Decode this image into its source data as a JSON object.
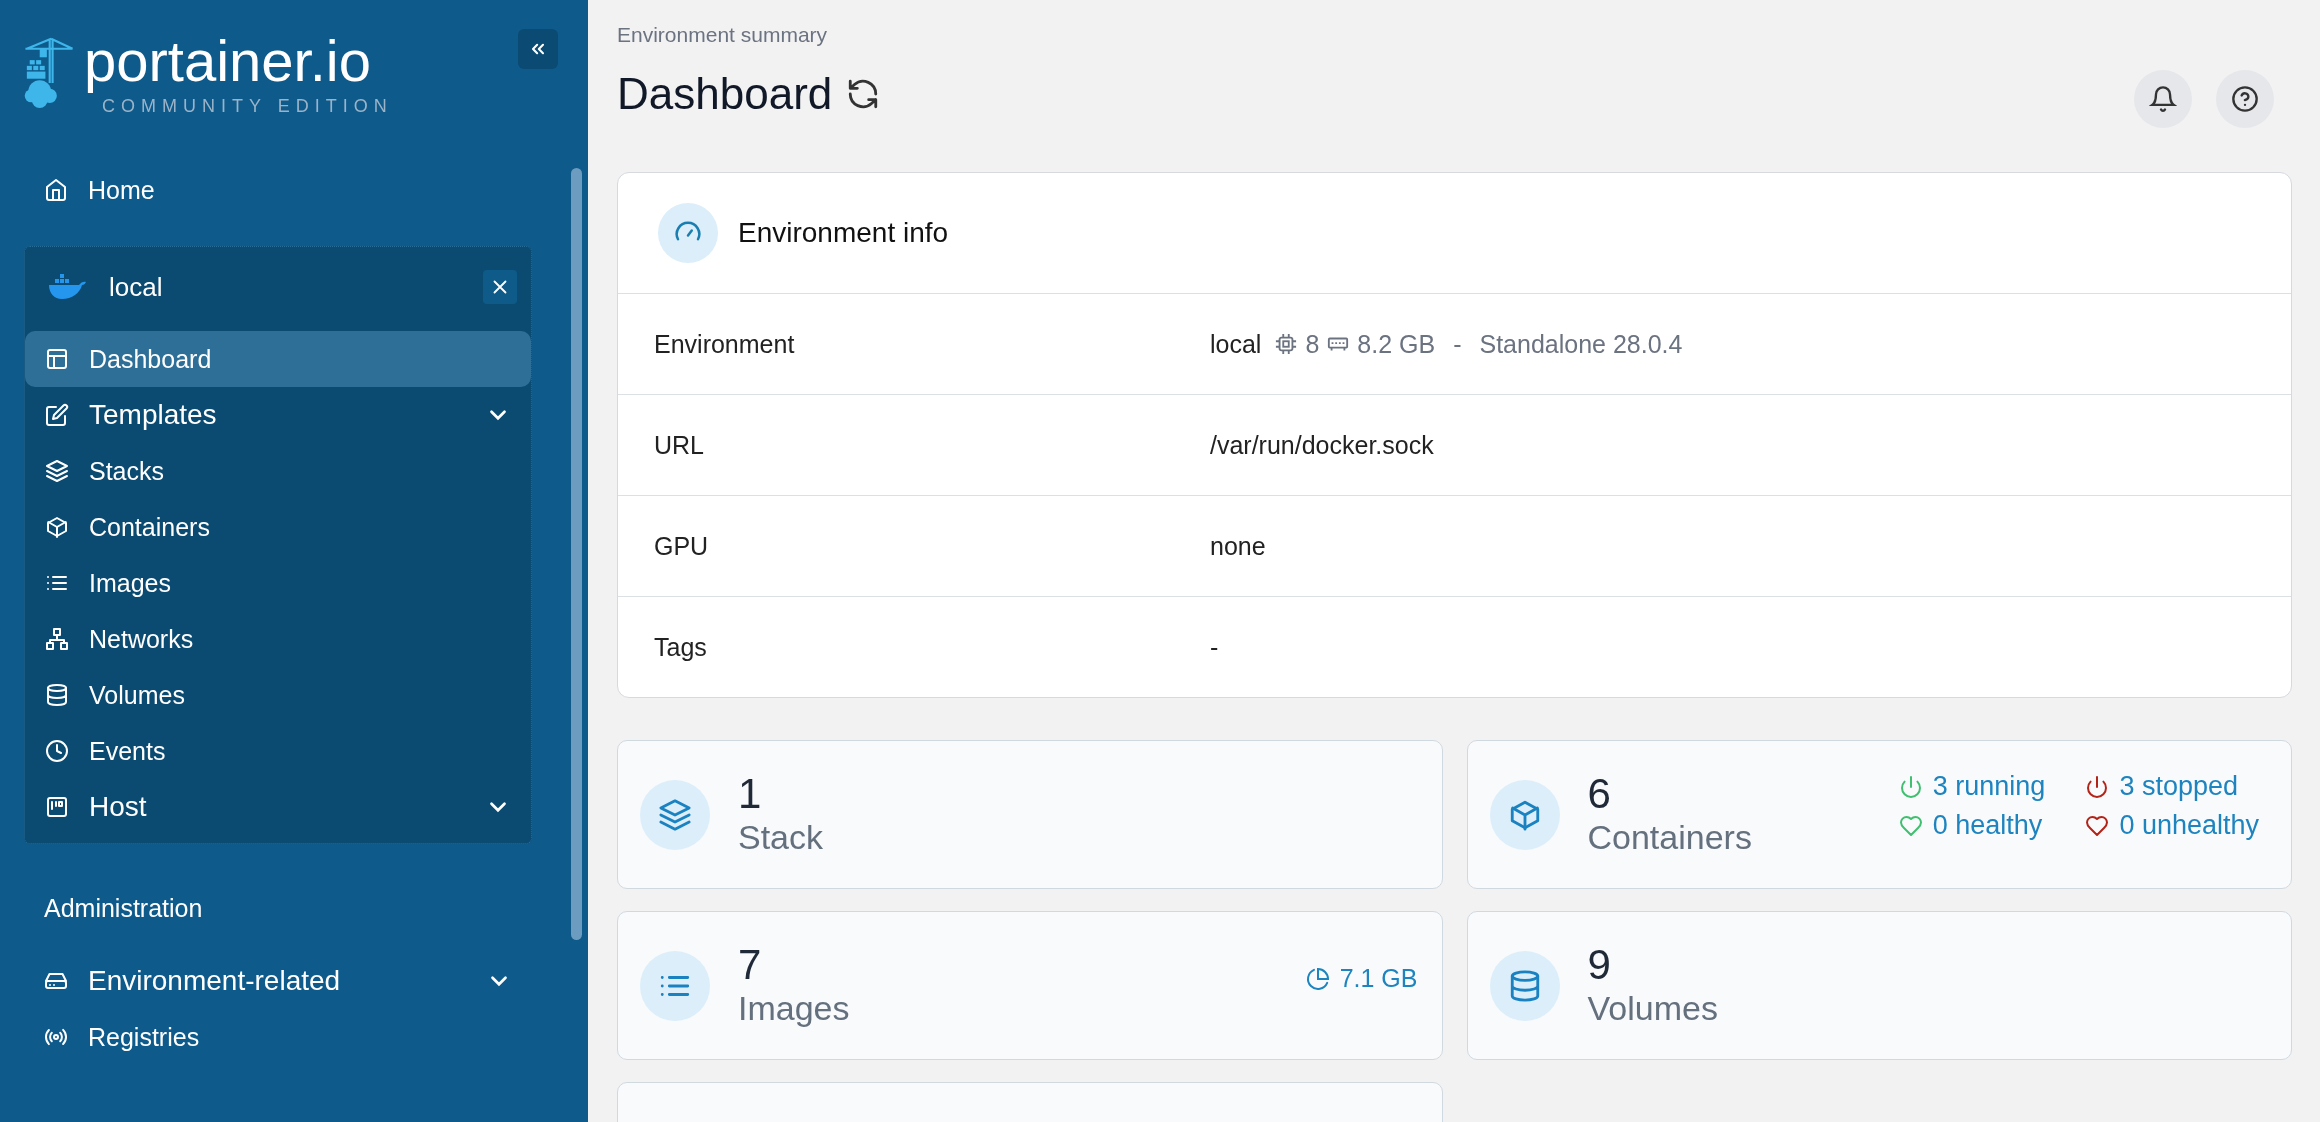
{
  "sidebar": {
    "logo": {
      "name": "portainer.io",
      "subtitle": "COMMUNITY EDITION"
    },
    "home": {
      "label": "Home"
    },
    "environment": {
      "name": "local",
      "items": [
        {
          "label": "Dashboard",
          "kind": "link",
          "selected": true
        },
        {
          "label": "Templates",
          "kind": "group",
          "selected": false,
          "expanded": false
        },
        {
          "label": "Stacks",
          "kind": "link",
          "selected": false
        },
        {
          "label": "Containers",
          "kind": "link",
          "selected": false
        },
        {
          "label": "Images",
          "kind": "link",
          "selected": false
        },
        {
          "label": "Networks",
          "kind": "link",
          "selected": false
        },
        {
          "label": "Volumes",
          "kind": "link",
          "selected": false
        },
        {
          "label": "Events",
          "kind": "link",
          "selected": false
        },
        {
          "label": "Host",
          "kind": "group",
          "selected": false,
          "expanded": false
        }
      ]
    },
    "admin_heading": "Administration",
    "admin_items": [
      {
        "label": "Environment-related",
        "kind": "group",
        "selected": false,
        "expanded": false
      },
      {
        "label": "Registries",
        "kind": "link",
        "selected": false
      }
    ]
  },
  "header": {
    "breadcrumb": "Environment summary",
    "title": "Dashboard"
  },
  "environment_info": {
    "title": "Environment info",
    "rows": [
      {
        "label": "Environment",
        "kind": "env",
        "name": "local",
        "cpu": "8",
        "memory": "8.2 GB",
        "separator": "-",
        "type": "Standalone 28.0.4"
      },
      {
        "label": "URL",
        "kind": "text",
        "value": "/var/run/docker.sock"
      },
      {
        "label": "GPU",
        "kind": "text",
        "value": "none"
      },
      {
        "label": "Tags",
        "kind": "text",
        "value": "-"
      }
    ]
  },
  "stats": [
    {
      "count": "1",
      "label": "Stack"
    },
    {
      "count": "6",
      "label": "Containers",
      "statuses": [
        {
          "text": "3 running",
          "kind": "power",
          "color": "#3fbf6f"
        },
        {
          "text": "3 stopped",
          "kind": "power",
          "color": "#b42318"
        },
        {
          "text": "0 healthy",
          "kind": "heart",
          "color": "#3fbf6f"
        },
        {
          "text": "0 unhealthy",
          "kind": "heart",
          "color": "#b42318"
        }
      ]
    },
    {
      "count": "7",
      "label": "Images",
      "size": "7.1 GB"
    },
    {
      "count": "9",
      "label": "Volumes"
    }
  ],
  "more_cards_below": true
}
